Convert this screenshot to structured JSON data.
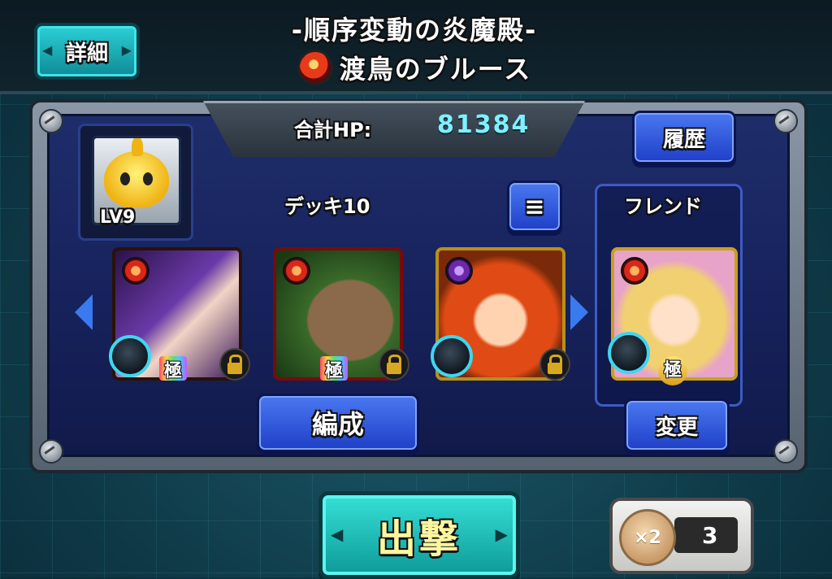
{
  "header": {
    "detail_label": "詳細",
    "title_line1": "-順序変動の炎魔殿-",
    "title_line2": "渡鳥のブルース"
  },
  "panel": {
    "hp_label": "合計HP:",
    "hp_value": "81384",
    "history_label": "履歴",
    "list_icon": "≡",
    "lv_label": "LV9",
    "deck_title": "デッキ10",
    "friend_title": "フレンド",
    "formation_label": "編成",
    "change_label": "変更",
    "cards": [
      {
        "gem": "極",
        "locked": true
      },
      {
        "gem": "極",
        "locked": true
      },
      {
        "locked": true
      },
      {
        "gem": "極"
      }
    ]
  },
  "footer": {
    "sortie_label": "出撃",
    "coin_label": "×2",
    "counter_value": "3"
  },
  "colors": {
    "accent_teal": "#2bd0d6",
    "button_blue": "#3a60e0",
    "hp_value": "#7ff0ff",
    "panel_bg": "#1e2d6a"
  }
}
